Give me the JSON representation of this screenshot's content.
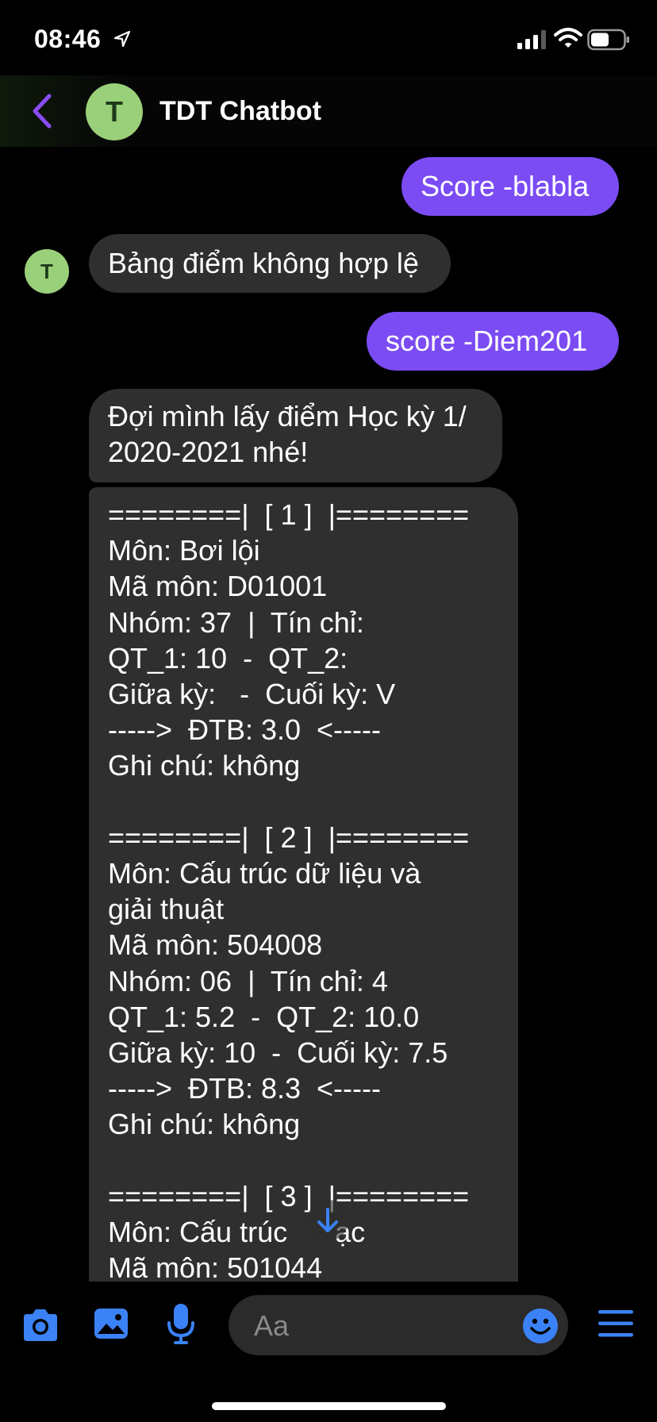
{
  "status": {
    "time": "08:46"
  },
  "header": {
    "avatar_letter": "T",
    "title": "TDT Chatbot"
  },
  "messages": {
    "m1": "Score -blabla",
    "m2_avatar": "T",
    "m2": "Bảng điểm không hợp lệ",
    "m3": "score -Diem201",
    "m4_line1": "Đợi mình lấy điểm Học kỳ 1/",
    "m4_line2": "2020-2021 nhé!",
    "m5": "========|  [ 1 ]  |========\nMôn: Bơi lội\nMã môn: D01001\nNhóm: 37  |  Tín chỉ:\nQT_1: 10  -  QT_2:\nGiữa kỳ:   -  Cuối kỳ: V\n----->  ĐTB: 3.0  <-----\nGhi chú: không\n\n========|  [ 2 ]  |========\nMôn: Cấu trúc dữ liệu và\ngiải thuật\nMã môn: 504008\nNhóm: 06  |  Tín chỉ: 4\nQT_1: 5.2  -  QT_2: 10.0\nGiữa kỳ: 10  -  Cuối kỳ: 7.5\n----->  ĐTB: 8.3  <-----\nGhi chú: không\n\n========|  [ 3 ]  |========\nMôn: Cấu trúc      ạc\nMã môn: 501044"
  },
  "composer": {
    "placeholder": "Aa"
  },
  "colors": {
    "accent": "#7b4cf4",
    "icon_blue": "#3b82f6",
    "bubble_in": "#2f2f2f",
    "avatar": "#9ad07a"
  }
}
